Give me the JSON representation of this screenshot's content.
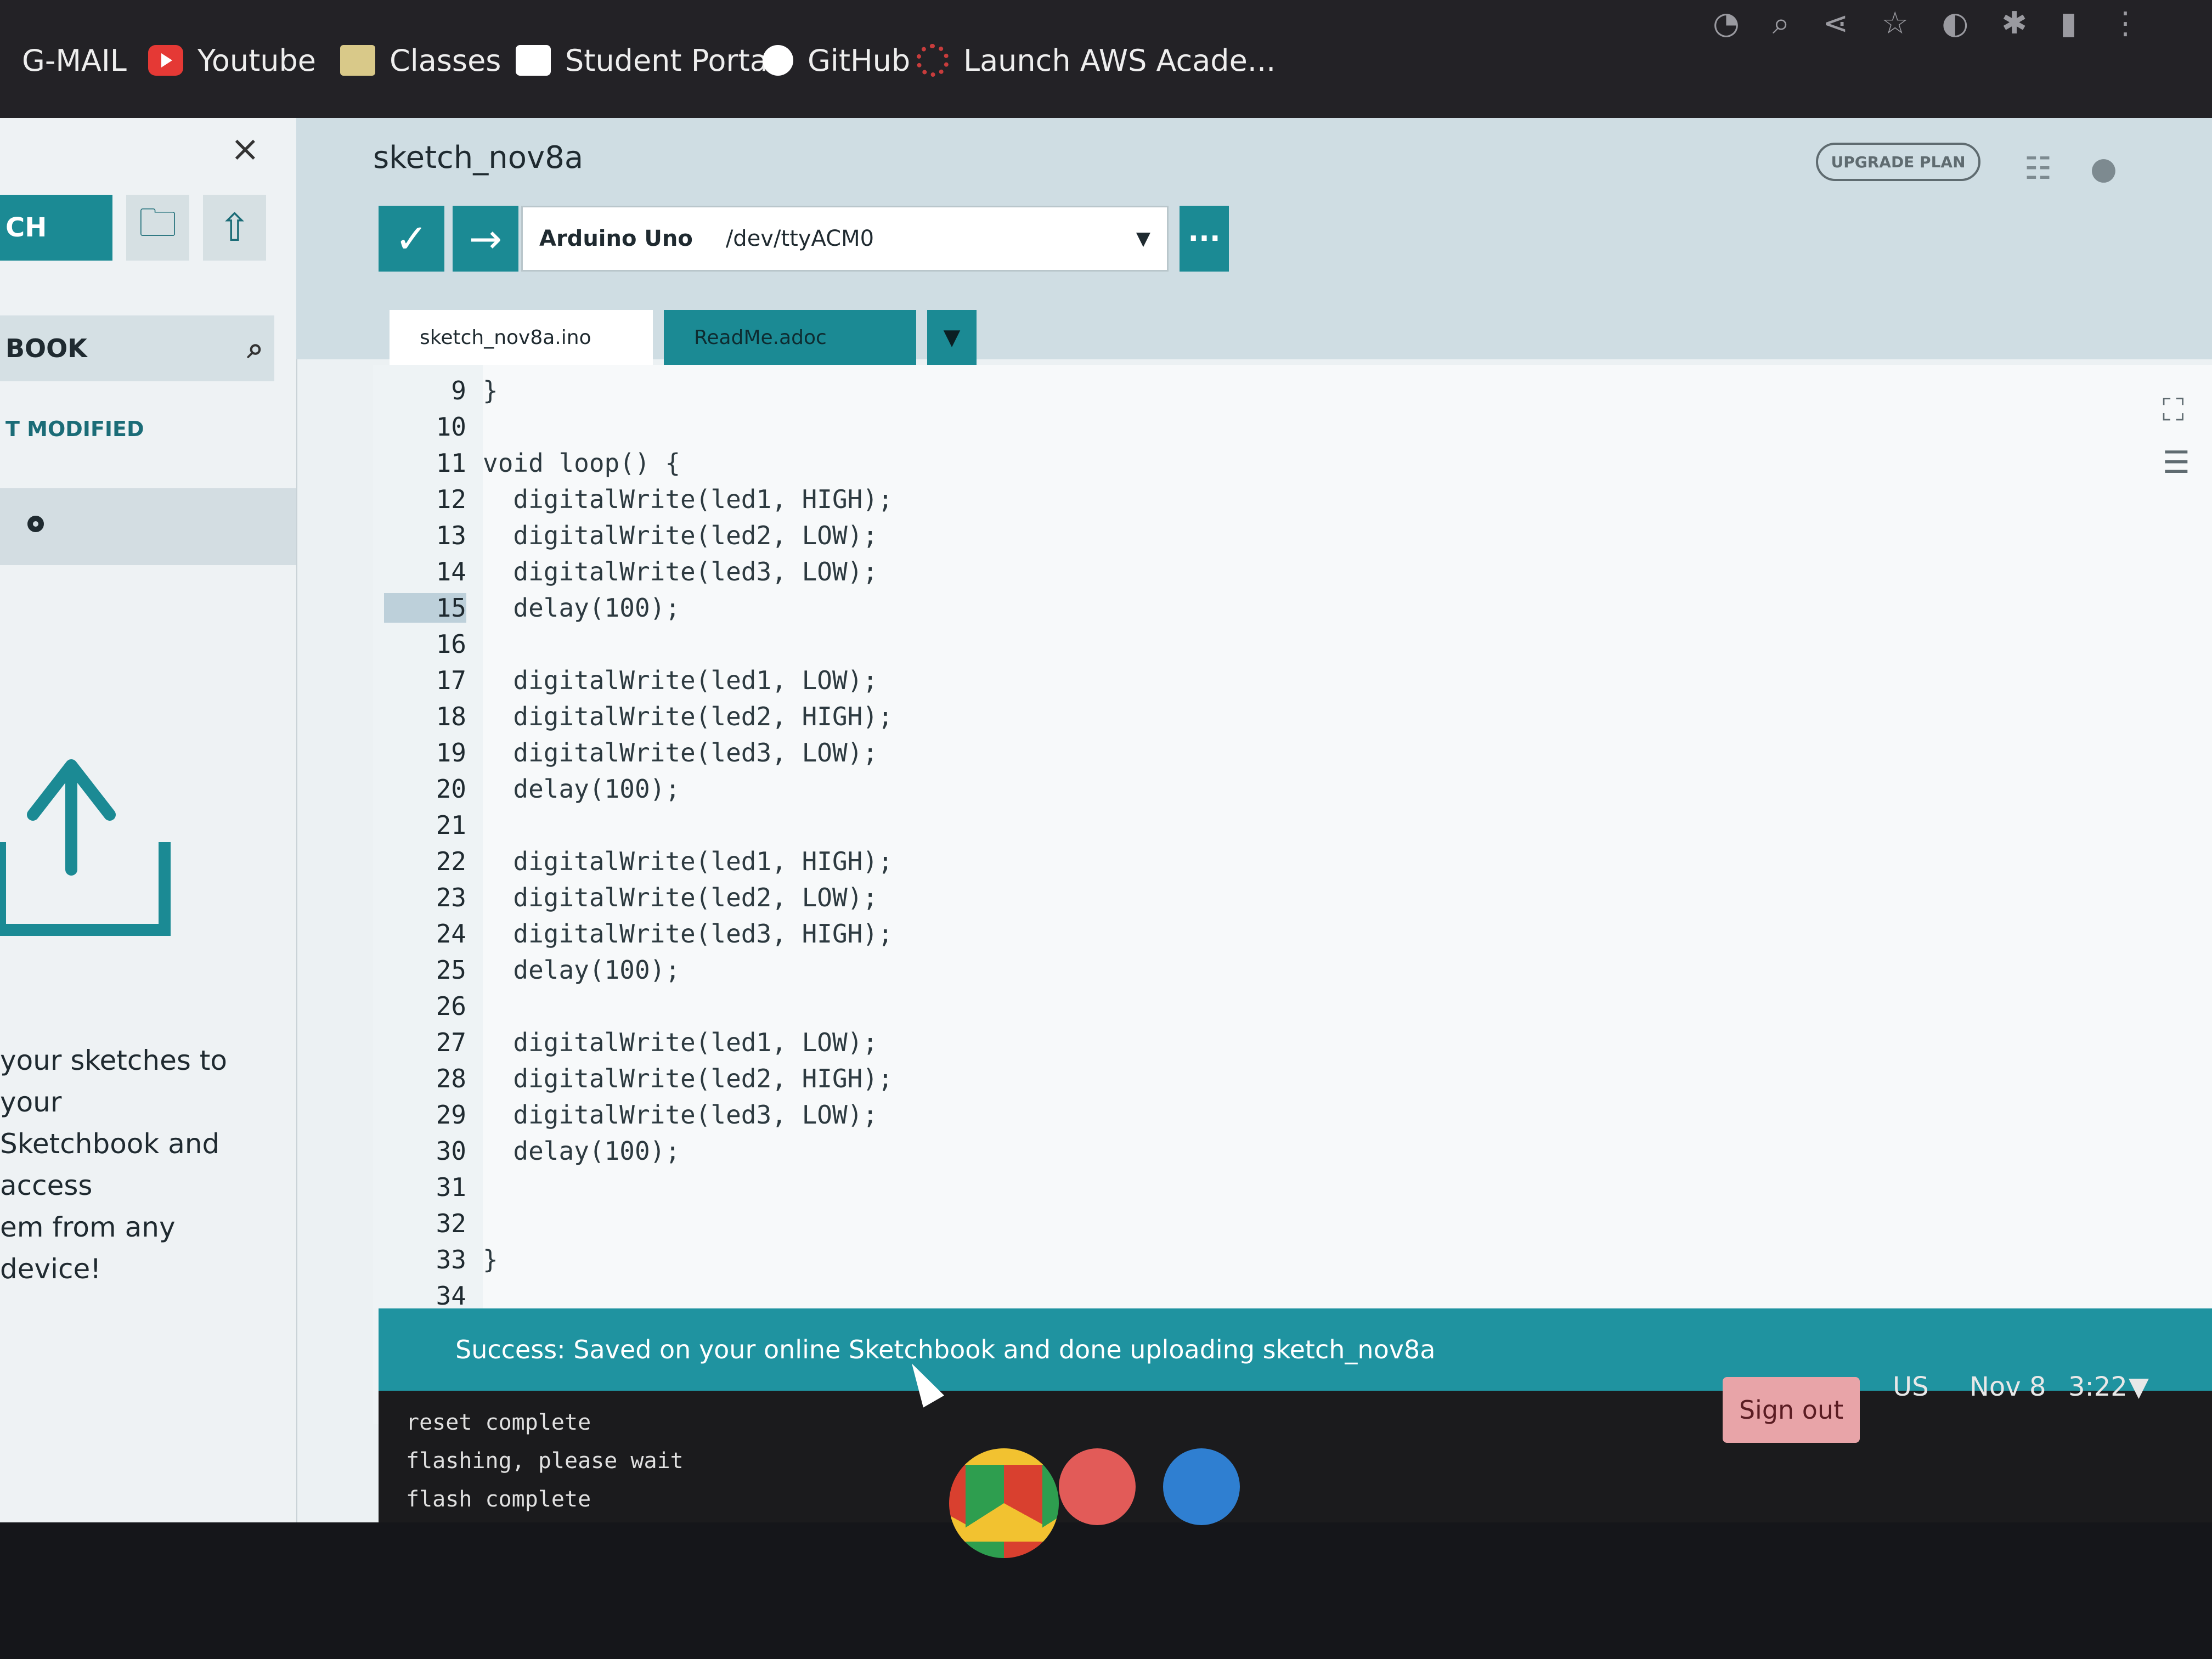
{
  "bookmarks": [
    {
      "label": "G-MAIL",
      "icon": "gmail-icon"
    },
    {
      "label": "Youtube",
      "icon": "youtube-icon"
    },
    {
      "label": "Classes",
      "icon": "classes-icon"
    },
    {
      "label": "Student Portal",
      "icon": "student-portal-icon"
    },
    {
      "label": "GitHub",
      "icon": "github-icon"
    },
    {
      "label": "Launch AWS Acade...",
      "icon": "aws-icon"
    }
  ],
  "sidebar": {
    "close": "×",
    "new_sketch_label": "CH",
    "header_label": "BOOK",
    "sort_label": "T MODIFIED",
    "promo_lines": [
      "your sketches to your",
      "Sketchbook and access",
      "em from any device!"
    ]
  },
  "editor": {
    "sketch_title": "sketch_nov8a",
    "upgrade_label": "UPGRADE PLAN",
    "board_name": "Arduino Uno",
    "board_port": "/dev/ttyACM0",
    "more_label": "···",
    "tabs": [
      {
        "label": "sketch_nov8a.ino",
        "active": true
      },
      {
        "label": "ReadMe.adoc",
        "active": false
      }
    ],
    "code_lines": [
      {
        "n": "9",
        "text": "}"
      },
      {
        "n": "10",
        "text": ""
      },
      {
        "n": "11",
        "text": "void loop() {"
      },
      {
        "n": "12",
        "text": "  digitalWrite(led1, HIGH);"
      },
      {
        "n": "13",
        "text": "  digitalWrite(led2, LOW);"
      },
      {
        "n": "14",
        "text": "  digitalWrite(led3, LOW);"
      },
      {
        "n": "15",
        "text": "  delay(100);"
      },
      {
        "n": "16",
        "text": ""
      },
      {
        "n": "17",
        "text": "  digitalWrite(led1, LOW);"
      },
      {
        "n": "18",
        "text": "  digitalWrite(led2, HIGH);"
      },
      {
        "n": "19",
        "text": "  digitalWrite(led3, LOW);"
      },
      {
        "n": "20",
        "text": "  delay(100);"
      },
      {
        "n": "21",
        "text": ""
      },
      {
        "n": "22",
        "text": "  digitalWrite(led1, HIGH);"
      },
      {
        "n": "23",
        "text": "  digitalWrite(led2, LOW);"
      },
      {
        "n": "24",
        "text": "  digitalWrite(led3, HIGH);"
      },
      {
        "n": "25",
        "text": "  delay(100);"
      },
      {
        "n": "26",
        "text": ""
      },
      {
        "n": "27",
        "text": "  digitalWrite(led1, LOW);"
      },
      {
        "n": "28",
        "text": "  digitalWrite(led2, HIGH);"
      },
      {
        "n": "29",
        "text": "  digitalWrite(led3, LOW);"
      },
      {
        "n": "30",
        "text": "  delay(100);"
      },
      {
        "n": "31",
        "text": ""
      },
      {
        "n": "32",
        "text": ""
      },
      {
        "n": "33",
        "text": "}"
      },
      {
        "n": "34",
        "text": ""
      }
    ],
    "current_line": "15"
  },
  "status": {
    "message": "Success: Saved on your online Sketchbook and done uploading sketch_nov8a"
  },
  "console": {
    "lines": [
      "reset complete",
      "flashing, please wait",
      "flash complete"
    ]
  },
  "shelf": {
    "apps": [
      {
        "name": "chrome-icon",
        "color": "#d9402f"
      },
      {
        "name": "canvas-icon",
        "color": "#e25b58"
      },
      {
        "name": "app-icon",
        "color": "#2f7fd1"
      }
    ],
    "sign_out_label": "Sign out",
    "locale": "US",
    "date": "Nov 8",
    "time": "3:22"
  }
}
